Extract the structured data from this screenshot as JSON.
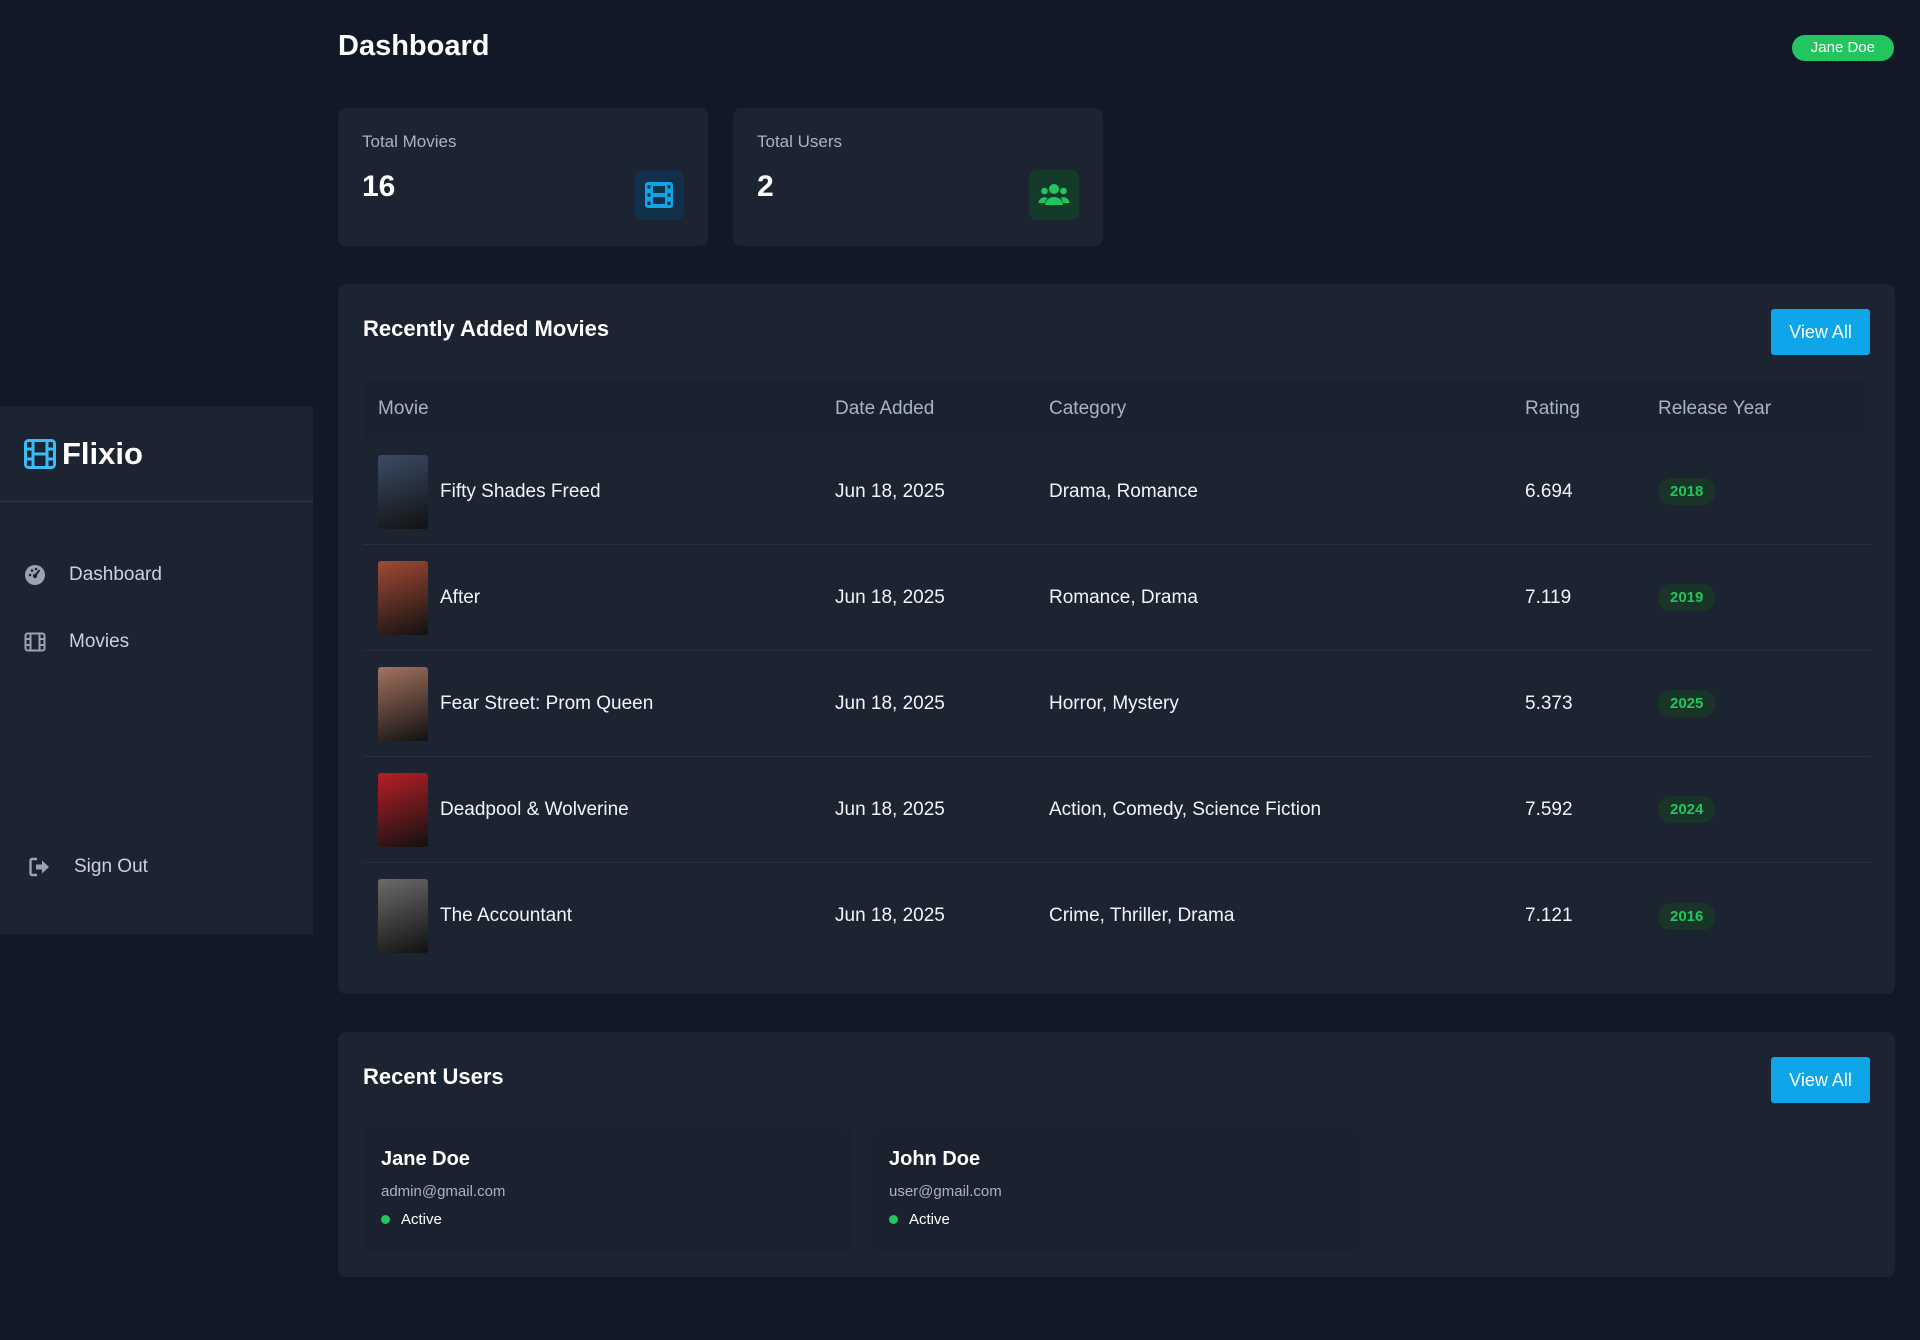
{
  "header": {
    "title": "Dashboard",
    "user_badge": "Jane Doe"
  },
  "sidebar": {
    "brand": "Flixio",
    "items": [
      {
        "label": "Dashboard",
        "icon": "dashboard-icon"
      },
      {
        "label": "Movies",
        "icon": "film-icon"
      }
    ],
    "signout_label": "Sign Out"
  },
  "stats": {
    "movies": {
      "label": "Total Movies",
      "value": "16",
      "icon": "film-icon"
    },
    "users": {
      "label": "Total Users",
      "value": "2",
      "icon": "users-icon"
    }
  },
  "recent_movies": {
    "title": "Recently Added Movies",
    "view_all": "View All",
    "columns": [
      "Movie",
      "Date Added",
      "Category",
      "Rating",
      "Release Year"
    ],
    "rows": [
      {
        "title": "Fifty Shades Freed",
        "date": "Jun 18, 2025",
        "category": "Drama, Romance",
        "rating": "6.694",
        "year": "2018",
        "poster_color": "#3b4c66"
      },
      {
        "title": "After",
        "date": "Jun 18, 2025",
        "category": "Romance, Drama",
        "rating": "7.119",
        "year": "2019",
        "poster_color": "#a24a35"
      },
      {
        "title": "Fear Street: Prom Queen",
        "date": "Jun 18, 2025",
        "category": "Horror, Mystery",
        "rating": "5.373",
        "year": "2025",
        "poster_color": "#a3735f"
      },
      {
        "title": "Deadpool & Wolverine",
        "date": "Jun 18, 2025",
        "category": "Action, Comedy, Science Fiction",
        "rating": "7.592",
        "year": "2024",
        "poster_color": "#b81f25"
      },
      {
        "title": "The Accountant",
        "date": "Jun 18, 2025",
        "category": "Crime, Thriller, Drama",
        "rating": "7.121",
        "year": "2016",
        "poster_color": "#6d6b6a"
      }
    ]
  },
  "recent_users": {
    "title": "Recent Users",
    "view_all": "View All",
    "users": [
      {
        "name": "Jane Doe",
        "email": "admin@gmail.com",
        "status": "Active"
      },
      {
        "name": "John Doe",
        "email": "user@gmail.com",
        "status": "Active"
      }
    ]
  },
  "colors": {
    "background": "#111827",
    "card": "#1c2431",
    "accent_blue": "#0ea5e9",
    "accent_green": "#22c55e"
  }
}
